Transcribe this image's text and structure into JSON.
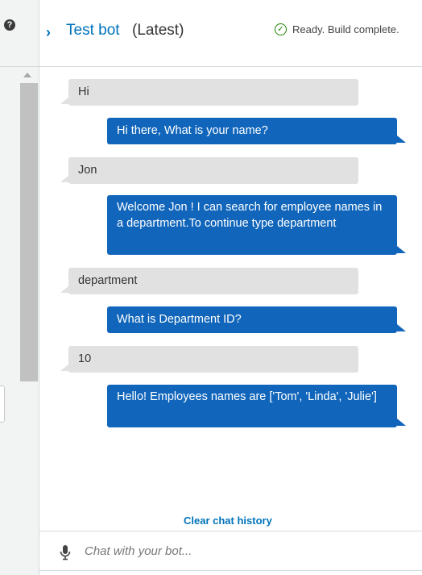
{
  "header": {
    "bot_name": "Test bot",
    "bot_version": "(Latest)",
    "status": "Ready. Build complete."
  },
  "messages": [
    {
      "from": "user",
      "text": "Hi"
    },
    {
      "from": "bot",
      "text": "Hi there, What is your name?"
    },
    {
      "from": "user",
      "text": "Jon"
    },
    {
      "from": "bot",
      "text": "Welcome Jon ! I can search for employee names in a department.To continue type department"
    },
    {
      "from": "user",
      "text": "department"
    },
    {
      "from": "bot",
      "text": "What is Department ID?"
    },
    {
      "from": "user",
      "text": "10"
    },
    {
      "from": "bot",
      "text": "Hello! Employees names are ['Tom', 'Linda', 'Julie']"
    }
  ],
  "clear_history_label": "Clear chat history",
  "input": {
    "placeholder": "Chat with your bot...",
    "value": ""
  },
  "colors": {
    "accent": "#0073bb",
    "bot_bubble": "#1166bb",
    "user_bubble": "#e1e1e1",
    "success": "#1d8102"
  }
}
